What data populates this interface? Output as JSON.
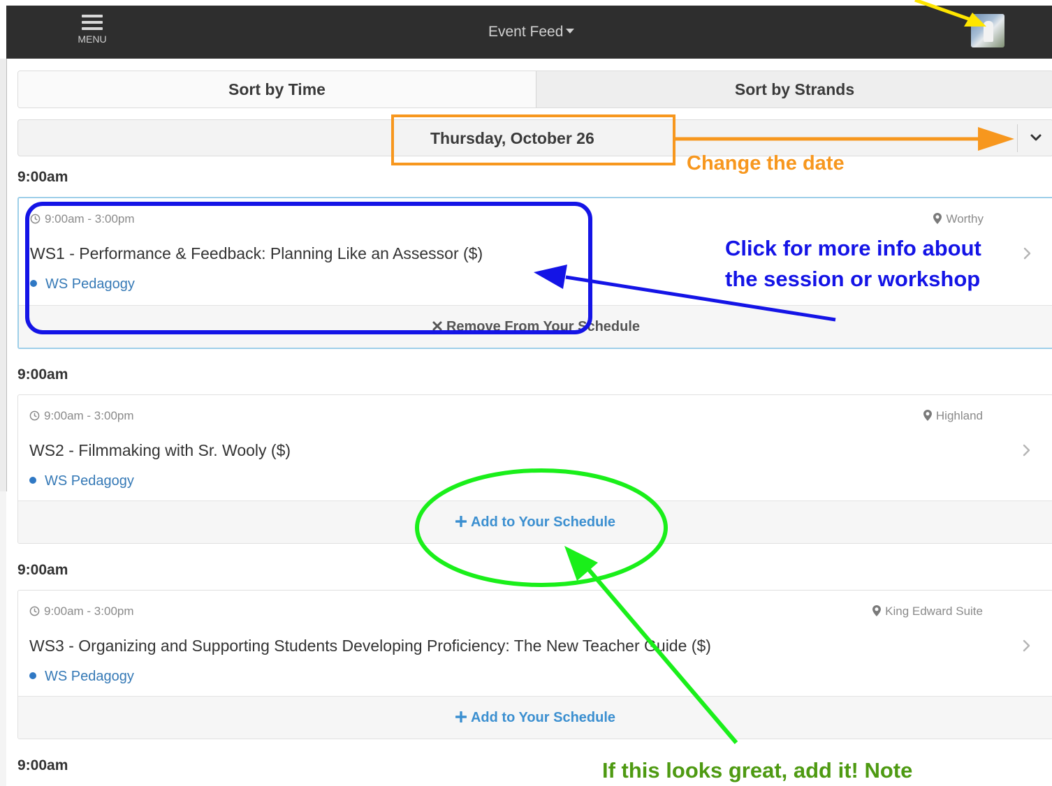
{
  "header": {
    "menu_label": "MENU",
    "feed_title": "Event Feed"
  },
  "sort_tabs": [
    {
      "label": "Sort by Time"
    },
    {
      "label": "Sort by Strands"
    }
  ],
  "date_selector": {
    "label": "Thursday, October 26"
  },
  "sessions": [
    {
      "time_header": "9:00am",
      "time_range": "9:00am - 3:00pm",
      "location": "Worthy",
      "title": "WS1 - Performance & Feedback: Planning Like an Assessor ($)",
      "strand": "WS Pedagogy",
      "action": "Remove From Your Schedule",
      "selected": true
    },
    {
      "time_header": "9:00am",
      "time_range": "9:00am - 3:00pm",
      "location": "Highland",
      "title": "WS2 - Filmmaking with Sr. Wooly ($)",
      "strand": "WS Pedagogy",
      "action": "Add to Your Schedule",
      "selected": false
    },
    {
      "time_header": "9:00am",
      "time_range": "9:00am - 3:00pm",
      "location": "King Edward Suite",
      "title": "WS3 - Organizing and Supporting Students Developing Proficiency: The New Teacher Guide ($)",
      "strand": "WS Pedagogy",
      "action": "Add to Your Schedule",
      "selected": false
    }
  ],
  "next_time_header": "9:00am",
  "annotations": {
    "change_date": "Change the date",
    "more_info_line1": "Click for more info about",
    "more_info_line2": "the session or workshop",
    "add_it": "If this looks great, add it! Note"
  },
  "colors": {
    "topbar": "#2e2e2e",
    "strand_blue": "#2f78c4",
    "add_blue": "#3b8fd0",
    "annotation_orange": "#f7971e",
    "annotation_blue": "#1414e6",
    "annotation_green": "#1aef1a",
    "annotation_green_text": "#4e9a12",
    "annotation_yellow": "#ffe600"
  }
}
